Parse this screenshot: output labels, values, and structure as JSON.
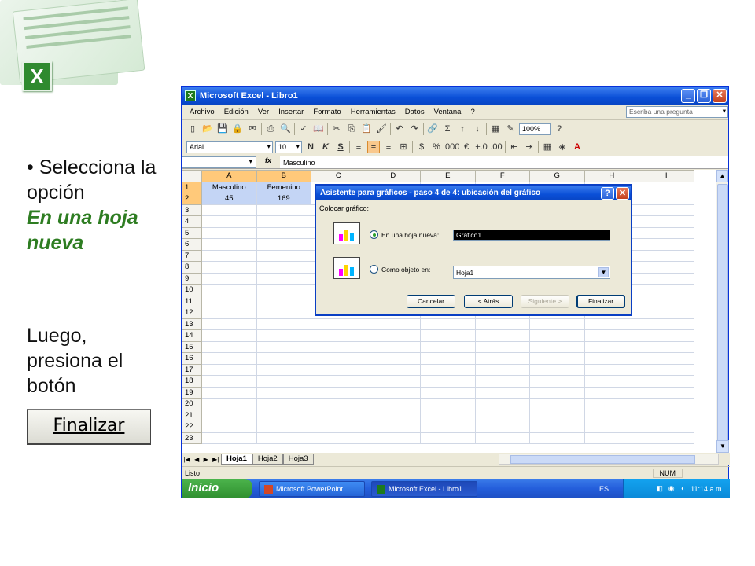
{
  "slide": {
    "bullet": "• Selecciona la opción",
    "emphasis": "En una hoja nueva",
    "instruction": "Luego, presiona el botón",
    "button_sample": "Finalizar"
  },
  "window": {
    "title": "Microsoft Excel - Libro1",
    "menu": [
      "Archivo",
      "Edición",
      "Ver",
      "Insertar",
      "Formato",
      "Herramientas",
      "Datos",
      "Ventana",
      "?"
    ],
    "ask_placeholder": "Escriba una pregunta",
    "zoom": "100%",
    "font_name": "Arial",
    "font_size": "10",
    "name_box": "",
    "fx_label": "fx",
    "formula_value": "Masculino"
  },
  "grid": {
    "columns": [
      "A",
      "B",
      "C",
      "D",
      "E",
      "F",
      "G",
      "H",
      "I"
    ],
    "rows": [
      "1",
      "2",
      "3",
      "4",
      "5",
      "6",
      "7",
      "8",
      "9",
      "10",
      "11",
      "12",
      "13",
      "14",
      "15",
      "16",
      "17",
      "18",
      "19",
      "20",
      "21",
      "22",
      "23"
    ],
    "cells": {
      "A1": "Masculino",
      "B1": "Femenino",
      "A2": "45",
      "B2": "169"
    }
  },
  "sheet_tabs": [
    "Hoja1",
    "Hoja2",
    "Hoja3"
  ],
  "status": {
    "left": "Listo",
    "num": "NUM"
  },
  "dialog": {
    "title": "Asistente para gráficos - paso 4 de 4: ubicación del gráfico",
    "group_label": "Colocar gráfico:",
    "option_new_sheet": "En una hoja nueva:",
    "new_sheet_value": "Gráfico1",
    "option_as_object": "Como objeto en:",
    "object_value": "Hoja1",
    "buttons": {
      "cancel": "Cancelar",
      "back": "< Atrás",
      "next": "Siguiente >",
      "finish": "Finalizar"
    }
  },
  "taskbar": {
    "start": "Inicio",
    "tasks": [
      "Microsoft PowerPoint ...",
      "Microsoft Excel - Libro1"
    ],
    "lang": "ES",
    "clock": "11:14 a.m."
  },
  "colors": {
    "accent_green": "#2e7d22",
    "titlebar_blue": "#0a4fd7",
    "selection_blue": "#c4d5f5"
  }
}
